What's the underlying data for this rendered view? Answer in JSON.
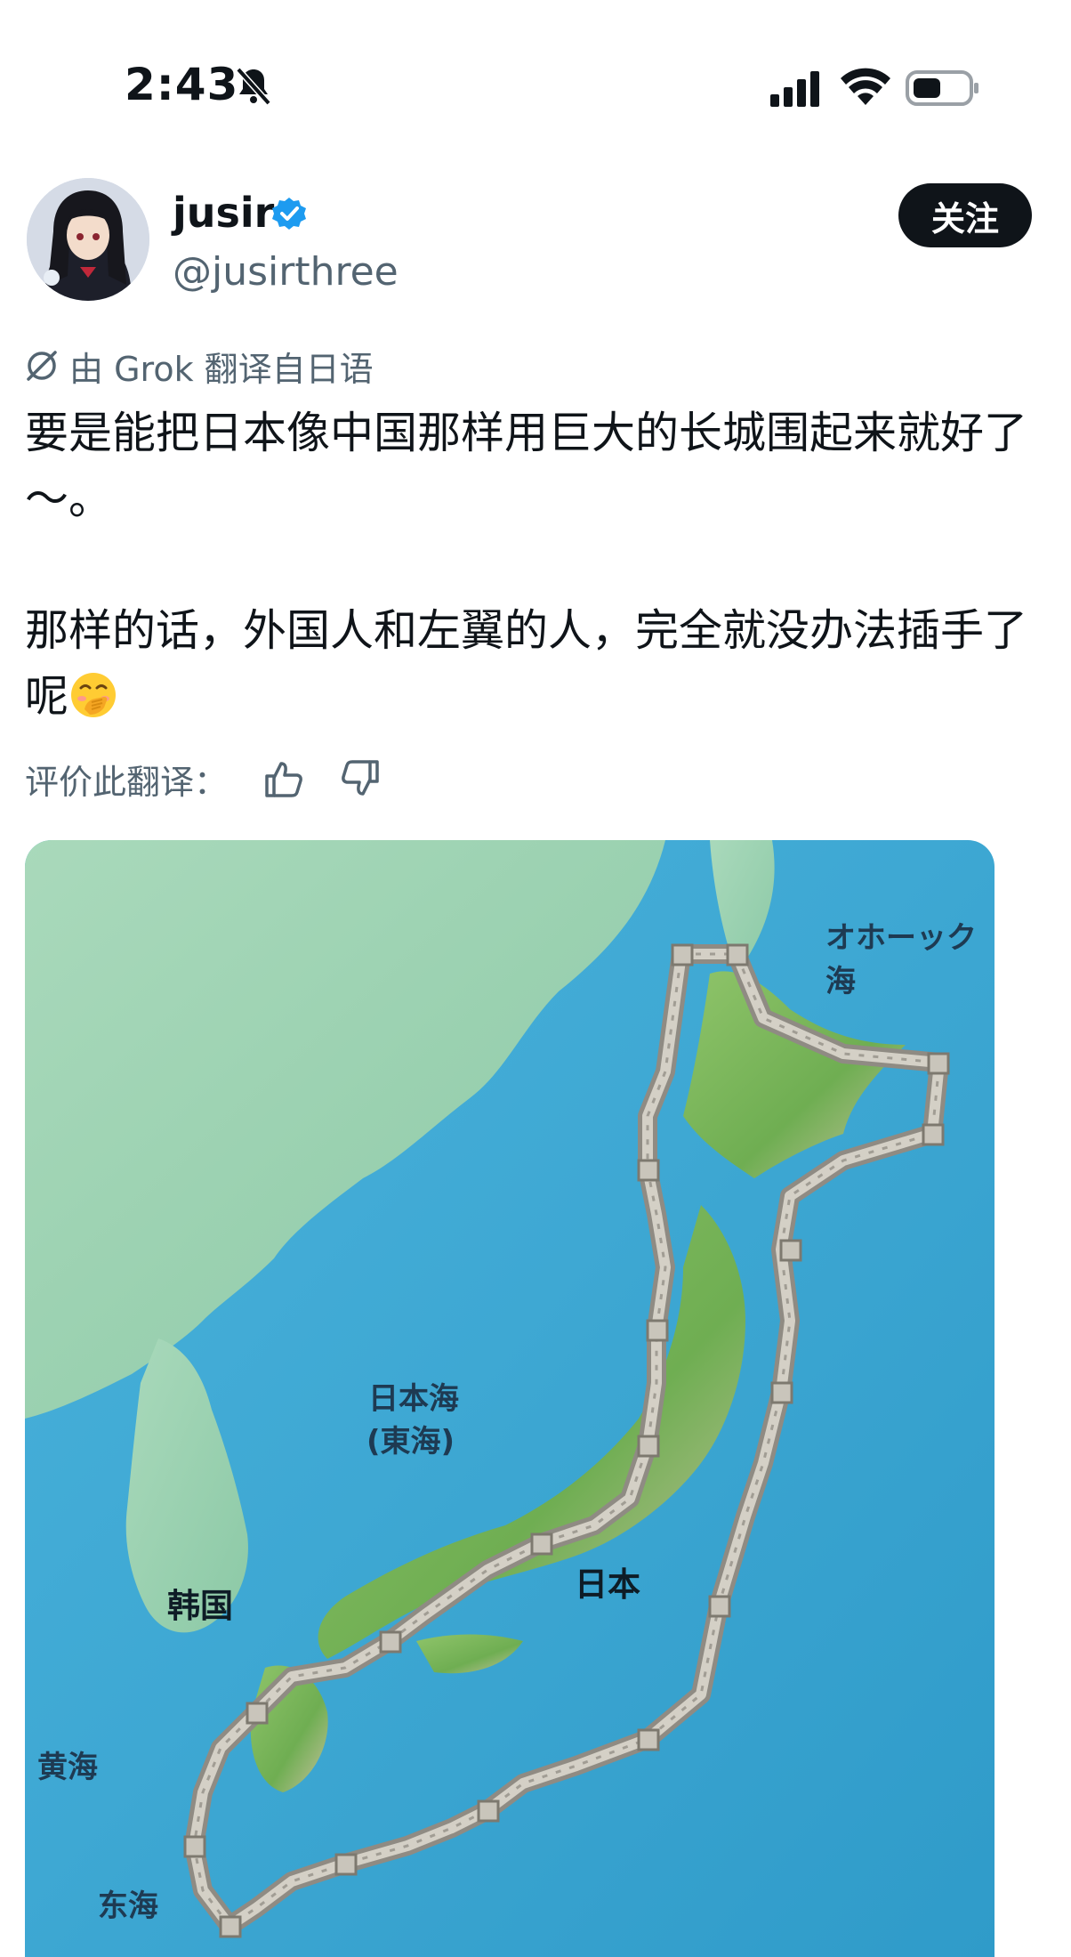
{
  "status_bar": {
    "time": "2:43"
  },
  "header": {
    "name": "jusir",
    "handle": "@jusirthree",
    "follow_label": "关注"
  },
  "translation_note": "由 Grok 翻译自日语",
  "tweet": {
    "line1": "要是能把日本像中国那样用巨大的长城围起来就好了～。",
    "line2": "那样的话，外国人和左翼的人，完全就没办法插手了呢"
  },
  "rate_translation_label": "评价此翻译：",
  "map_labels": {
    "okhotsk": "オホーック海",
    "sea_of_japan": "日本海",
    "east_sea": "(東海)",
    "japan": "日本",
    "korea": "韩国",
    "yellow_sea": "黄海",
    "east_china_sea": "东海"
  },
  "colors": {
    "sea": "#3aa6d2",
    "land": "#9fd2b2",
    "wall": "#b7b3aa",
    "verified": "#1d9bf0"
  }
}
